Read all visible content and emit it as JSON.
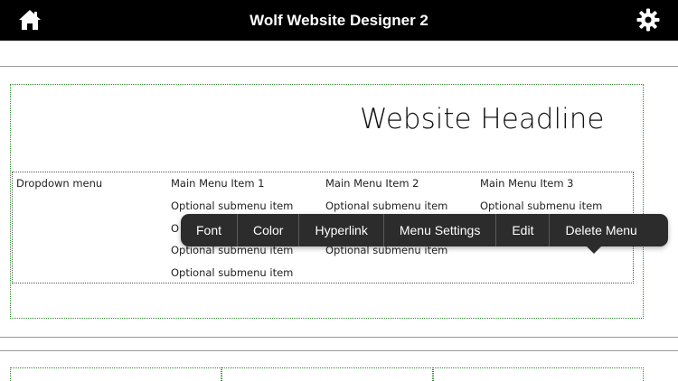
{
  "app": {
    "title": "Wolf Website Designer 2"
  },
  "icons": {
    "home": "home-icon",
    "settings": "gear-icon"
  },
  "headline": "Website Headline",
  "menu": {
    "dropdown_label": "Dropdown menu",
    "columns": [
      {
        "title": "Main Menu Item 1",
        "items": [
          "Optional submenu item",
          "Optional submenu item",
          "Optional submenu item",
          "Optional submenu item"
        ]
      },
      {
        "title": "Main Menu Item 2",
        "items": [
          "Optional submenu item",
          "Optional submenu item",
          "Optional submenu item"
        ]
      },
      {
        "title": "Main Menu Item 3",
        "items": [
          "Optional submenu item"
        ]
      }
    ],
    "partial_char": "O"
  },
  "context_menu": {
    "items": [
      "Font",
      "Color",
      "Hyperlink",
      "Menu Settings",
      "Edit",
      "Delete Menu"
    ]
  },
  "colors": {
    "topbar": "#000000",
    "popup": "#2c2c2c",
    "guide_green": "#2e8b2e"
  }
}
